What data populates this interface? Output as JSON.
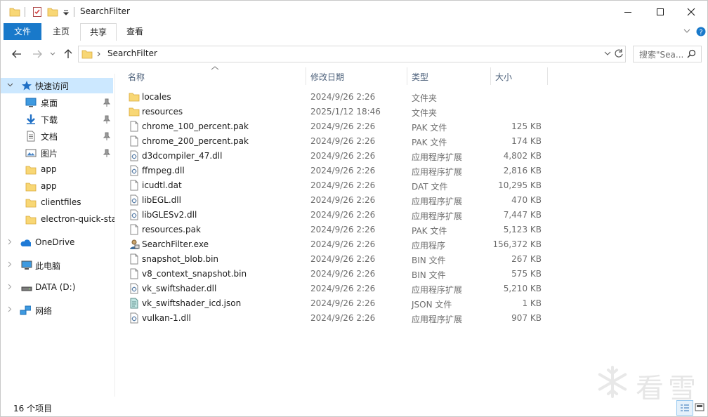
{
  "window": {
    "title": "SearchFilter"
  },
  "ribbon": {
    "tabs": [
      {
        "label": "文件"
      },
      {
        "label": "主页"
      },
      {
        "label": "共享"
      },
      {
        "label": "查看"
      }
    ]
  },
  "address": {
    "path": "SearchFilter"
  },
  "search": {
    "placeholder": "搜索\"Sea...",
    "text": "搜索\"Sea..."
  },
  "nav": {
    "quick_access": "快速访问",
    "items": [
      {
        "label": "桌面"
      },
      {
        "label": "下载"
      },
      {
        "label": "文档"
      },
      {
        "label": "图片"
      },
      {
        "label": "app"
      },
      {
        "label": "app"
      },
      {
        "label": "clientfiles"
      },
      {
        "label": "electron-quick-sta"
      }
    ],
    "onedrive": "OneDrive",
    "this_pc": "此电脑",
    "drive": "DATA (D:)",
    "network": "网络"
  },
  "columns": {
    "name": "名称",
    "date": "修改日期",
    "type": "类型",
    "size": "大小"
  },
  "files": [
    {
      "name": "locales",
      "date": "2024/9/26 2:26",
      "type": "文件夹",
      "size": "",
      "icon": "folder"
    },
    {
      "name": "resources",
      "date": "2025/1/12 18:46",
      "type": "文件夹",
      "size": "",
      "icon": "folder"
    },
    {
      "name": "chrome_100_percent.pak",
      "date": "2024/9/26 2:26",
      "type": "PAK 文件",
      "size": "125 KB",
      "icon": "file"
    },
    {
      "name": "chrome_200_percent.pak",
      "date": "2024/9/26 2:26",
      "type": "PAK 文件",
      "size": "174 KB",
      "icon": "file"
    },
    {
      "name": "d3dcompiler_47.dll",
      "date": "2024/9/26 2:26",
      "type": "应用程序扩展",
      "size": "4,802 KB",
      "icon": "dll"
    },
    {
      "name": "ffmpeg.dll",
      "date": "2024/9/26 2:26",
      "type": "应用程序扩展",
      "size": "2,816 KB",
      "icon": "dll"
    },
    {
      "name": "icudtl.dat",
      "date": "2024/9/26 2:26",
      "type": "DAT 文件",
      "size": "10,295 KB",
      "icon": "file"
    },
    {
      "name": "libEGL.dll",
      "date": "2024/9/26 2:26",
      "type": "应用程序扩展",
      "size": "470 KB",
      "icon": "dll"
    },
    {
      "name": "libGLESv2.dll",
      "date": "2024/9/26 2:26",
      "type": "应用程序扩展",
      "size": "7,447 KB",
      "icon": "dll"
    },
    {
      "name": "resources.pak",
      "date": "2024/9/26 2:26",
      "type": "PAK 文件",
      "size": "5,123 KB",
      "icon": "file"
    },
    {
      "name": "SearchFilter.exe",
      "date": "2024/9/26 2:26",
      "type": "应用程序",
      "size": "156,372 KB",
      "icon": "exe"
    },
    {
      "name": "snapshot_blob.bin",
      "date": "2024/9/26 2:26",
      "type": "BIN 文件",
      "size": "267 KB",
      "icon": "file"
    },
    {
      "name": "v8_context_snapshot.bin",
      "date": "2024/9/26 2:26",
      "type": "BIN 文件",
      "size": "575 KB",
      "icon": "file"
    },
    {
      "name": "vk_swiftshader.dll",
      "date": "2024/9/26 2:26",
      "type": "应用程序扩展",
      "size": "5,210 KB",
      "icon": "dll"
    },
    {
      "name": "vk_swiftshader_icd.json",
      "date": "2024/9/26 2:26",
      "type": "JSON 文件",
      "size": "1 KB",
      "icon": "json"
    },
    {
      "name": "vulkan-1.dll",
      "date": "2024/9/26 2:26",
      "type": "应用程序扩展",
      "size": "907 KB",
      "icon": "dll"
    }
  ],
  "status": {
    "count": "16 个项目"
  },
  "watermark": {
    "text": "看雪"
  },
  "colors": {
    "accent": "#1979ca",
    "selection": "#cce8ff",
    "folder": "#f8d775"
  }
}
